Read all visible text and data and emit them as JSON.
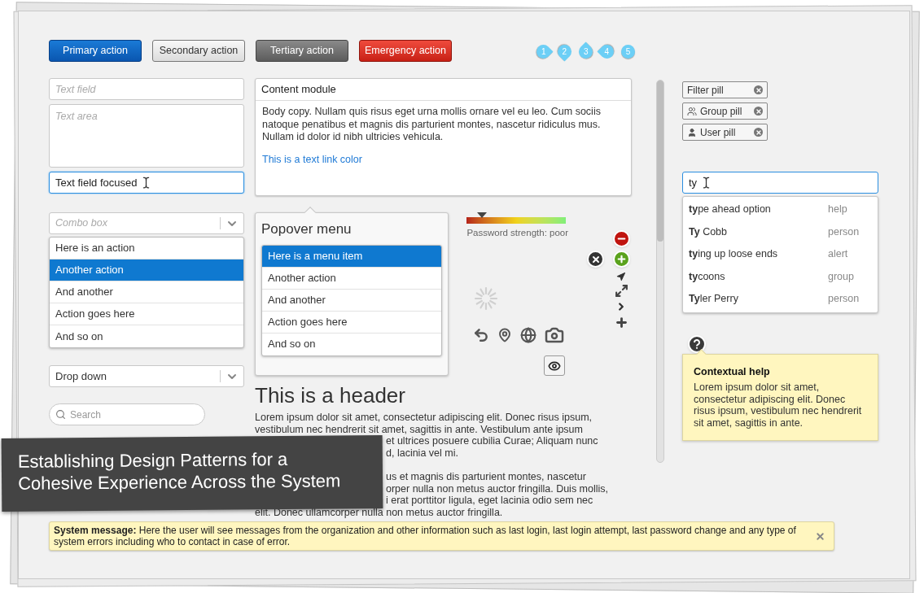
{
  "buttons": [
    {
      "label": "Primary action",
      "kind": "primary"
    },
    {
      "label": "Secondary action",
      "kind": "secondary"
    },
    {
      "label": "Tertiary action",
      "kind": "tertiary"
    },
    {
      "label": "Emergency action",
      "kind": "emergency"
    }
  ],
  "step_markers": [
    {
      "label": "1",
      "kind": "right"
    },
    {
      "label": "2",
      "kind": "down"
    },
    {
      "label": "3",
      "kind": "up"
    },
    {
      "label": "4",
      "kind": "left"
    },
    {
      "label": "5",
      "kind": "round"
    }
  ],
  "text_field": {
    "placeholder": "Text field"
  },
  "text_area": {
    "placeholder": "Text area"
  },
  "focused_field": {
    "value": "Text field focused"
  },
  "combo_box": {
    "placeholder": "Combo box",
    "items": [
      {
        "label": "Here is an action",
        "selected": false
      },
      {
        "label": "Another action",
        "selected": true
      },
      {
        "label": "And another",
        "selected": false
      },
      {
        "label": "Action goes here",
        "selected": false
      },
      {
        "label": "And so on",
        "selected": false
      }
    ]
  },
  "drop_down": {
    "value": "Drop down"
  },
  "search": {
    "placeholder": "Search"
  },
  "content_module": {
    "title": "Content module",
    "body": "Body copy. Nullam quis risus eget urna mollis ornare vel eu leo. Cum sociis natoque penatibus et magnis dis parturient montes, nascetur ridiculus mus. Nullam id dolor id nibh ultricies vehicula.",
    "link": "This is a text link color"
  },
  "popover_menu": {
    "title": "Popover menu",
    "items": [
      {
        "label": "Here is a menu item",
        "selected": true
      },
      {
        "label": "Another action",
        "selected": false
      },
      {
        "label": "And another",
        "selected": false
      },
      {
        "label": "Action goes here",
        "selected": false
      },
      {
        "label": "And so on",
        "selected": false
      }
    ]
  },
  "password_meter": {
    "level": 0.15,
    "label": "Password strength: poor"
  },
  "header": "This is a header",
  "paragraphs": [
    {
      "lines": [
        {
          "text": "Lorem ipsum dolor sit amet, consectetur adipiscing elit. Donec risus ipsum,",
          "kind": "full"
        },
        {
          "text": "vestibulum nec hendrerit sit amet, sagittis in ante. Vestibulum ante ipsum",
          "kind": "full"
        },
        {
          "text": "et ultrices posuere cubilia Curae; Aliquam nunc",
          "kind": "fragment"
        },
        {
          "text": "d, lacinia vel mi.",
          "kind": "fragment"
        }
      ]
    },
    {
      "lines": [
        {
          "text": "us et magnis dis parturient montes, nascetur",
          "kind": "fragment"
        },
        {
          "text": "orper nulla non metus auctor fringilla. Duis mollis,",
          "kind": "fragment"
        },
        {
          "text": "i erat porttitor ligula, eget lacinia odio sem nec",
          "kind": "fragment"
        },
        {
          "text": "elit. Donec ullamcorper nulla non metus auctor fringilla.",
          "kind": "full"
        }
      ]
    }
  ],
  "pills": [
    {
      "label": "Filter pill",
      "kind": "filter"
    },
    {
      "label": "Group pill",
      "kind": "group"
    },
    {
      "label": "User pill",
      "kind": "user"
    }
  ],
  "type_ahead": {
    "value": "ty",
    "options": [
      {
        "label": "**ty**pe ahead option",
        "type": "help"
      },
      {
        "label": "**Ty** Cobb",
        "type": "person"
      },
      {
        "label": "**ty**ing up loose ends",
        "type": "alert"
      },
      {
        "label": "**ty**coons",
        "type": "group"
      },
      {
        "label": "**Ty**ler Perry",
        "type": "person"
      }
    ]
  },
  "contextual_help": {
    "title": "Contextual help",
    "body": "Lorem ipsum dolor sit amet, consectetur adipiscing elit. Donec risus ipsum, vestibulum nec hendrerit sit amet, sagittis in ante."
  },
  "system_message": {
    "label": "System message:",
    "text": "Here the user will see messages from the organization and other information such as last login, last login attempt, last password change and any type of system errors including who to contact in case of error."
  },
  "banner": {
    "lines": [
      "Establishing Design Patterns for a",
      "Cohesive Experience Across the System"
    ]
  }
}
